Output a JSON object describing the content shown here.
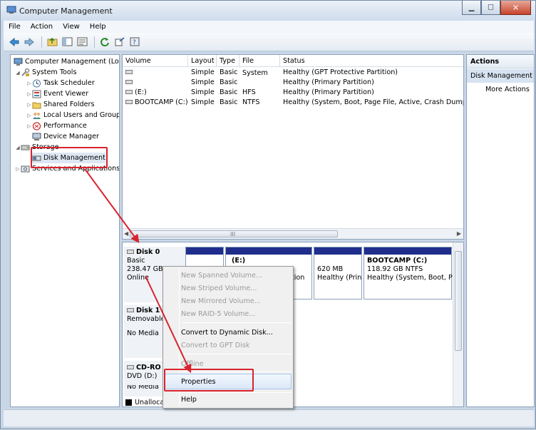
{
  "window": {
    "title": "Computer Management"
  },
  "menu": [
    "File",
    "Action",
    "View",
    "Help"
  ],
  "toolbar": {
    "icons": [
      "back-arrow-icon",
      "forward-arrow-icon",
      "up-folder-icon",
      "show-hide-tree-icon",
      "properties-icon",
      "refresh-icon",
      "export-icon",
      "help-icon"
    ]
  },
  "tree": {
    "root": "Computer Management (Local",
    "system_tools": "System Tools",
    "task_scheduler": "Task Scheduler",
    "event_viewer": "Event Viewer",
    "shared_folders": "Shared Folders",
    "local_users": "Local Users and Groups",
    "performance": "Performance",
    "device_manager": "Device Manager",
    "storage": "Storage",
    "disk_management": "Disk Management",
    "services": "Services and Applications"
  },
  "volumes": {
    "headers": [
      "Volume",
      "Layout",
      "Type",
      "File System",
      "Status"
    ],
    "rows": [
      {
        "volume": "",
        "layout": "Simple",
        "type": "Basic",
        "fs": "",
        "status": "Healthy (GPT Protective Partition)"
      },
      {
        "volume": "",
        "layout": "Simple",
        "type": "Basic",
        "fs": "",
        "status": "Healthy (Primary Partition)"
      },
      {
        "volume": "(E:)",
        "layout": "Simple",
        "type": "Basic",
        "fs": "HFS",
        "status": "Healthy (Primary Partition)"
      },
      {
        "volume": "BOOTCAMP (C:)",
        "layout": "Simple",
        "type": "Basic",
        "fs": "NTFS",
        "status": "Healthy (System, Boot, Page File, Active, Crash Dump, Prim"
      }
    ]
  },
  "disks": {
    "disk0": {
      "name": "Disk 0",
      "type": "Basic",
      "size": "238.47 GB",
      "state": "Online"
    },
    "disk0_partitions": {
      "p2_line1": "(E:)",
      "p2_line2": "tion",
      "p3_line1": "620 MB",
      "p3_line2": "Healthy (Prin",
      "p4_line1": "BOOTCAMP  (C:)",
      "p4_line2": "118.92 GB NTFS",
      "p4_line3": "Healthy (System, Boot, Pag"
    },
    "disk1": {
      "name": "Disk 1",
      "type": "Removable",
      "state": "No Media"
    },
    "cdrom": {
      "name": "CD-RO",
      "drive": "DVD (D:)",
      "state": "No Media"
    },
    "legend": "Unalloca"
  },
  "actions": {
    "header": "Actions",
    "section": "Disk Management",
    "more": "More Actions"
  },
  "context_menu": {
    "new_spanned": "New Spanned Volume...",
    "new_striped": "New Striped Volume...",
    "new_mirrored": "New Mirrored Volume...",
    "new_raid5": "New RAID-5 Volume...",
    "convert_dynamic": "Convert to Dynamic Disk...",
    "convert_gpt": "Convert to GPT Disk",
    "offline": "Offline",
    "properties": "Properties",
    "help": "Help"
  },
  "colors": {
    "annotation_red": "#d9232e",
    "partition_bar": "#1f2e8c"
  }
}
